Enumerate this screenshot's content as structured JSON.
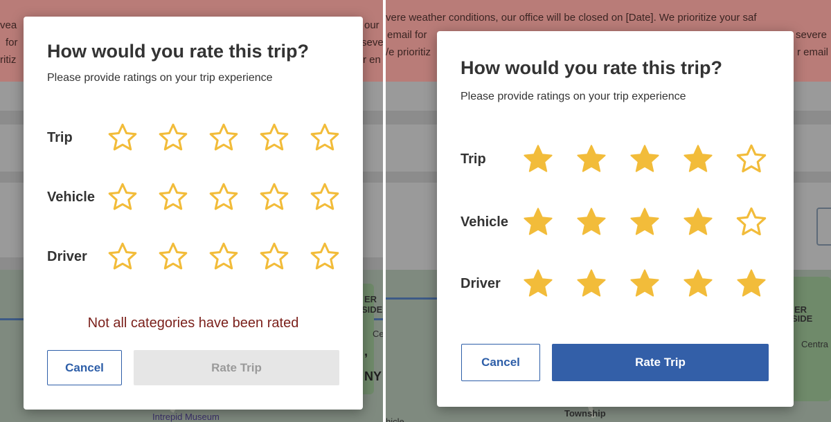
{
  "colors": {
    "star": "#f2bc3a",
    "primary": "#335fa8",
    "error": "#7a1f1a"
  },
  "left": {
    "background": {
      "banner_lines": [
        "vea",
        "for",
        "ritiz"
      ],
      "banner_lines_right": [
        "our",
        "seve",
        "r en"
      ],
      "map_labels": [
        "Intrepid Museum"
      ],
      "side_text": [
        ",",
        "NY",
        "ER",
        "SIDE",
        "Ce"
      ]
    },
    "dialog": {
      "title": "How would you rate this trip?",
      "subtitle": "Please provide ratings on your trip experience",
      "ratings": [
        {
          "label": "Trip",
          "value": 0,
          "max": 5
        },
        {
          "label": "Vehicle",
          "value": 0,
          "max": 5
        },
        {
          "label": "Driver",
          "value": 0,
          "max": 5
        }
      ],
      "error": "Not all categories have been rated",
      "cancel_label": "Cancel",
      "rate_label": "Rate Trip",
      "rate_enabled": false
    }
  },
  "right": {
    "background": {
      "banner_lines": [
        "vere weather conditions, our office will be closed on [Date]. We prioritize your saf",
        "email for",
        "/e prioritiz"
      ],
      "banner_right": [
        "severe",
        "r email"
      ],
      "map_labels": [
        "Township",
        "hicle"
      ],
      "side_text": [
        "ER",
        "SIDE",
        "Centra"
      ]
    },
    "dialog": {
      "title": "How would you rate this trip?",
      "subtitle": "Please provide ratings on your trip experience",
      "ratings": [
        {
          "label": "Trip",
          "value": 4,
          "max": 5
        },
        {
          "label": "Vehicle",
          "value": 4,
          "max": 5
        },
        {
          "label": "Driver",
          "value": 5,
          "max": 5
        }
      ],
      "cancel_label": "Cancel",
      "rate_label": "Rate Trip",
      "rate_enabled": true
    }
  }
}
